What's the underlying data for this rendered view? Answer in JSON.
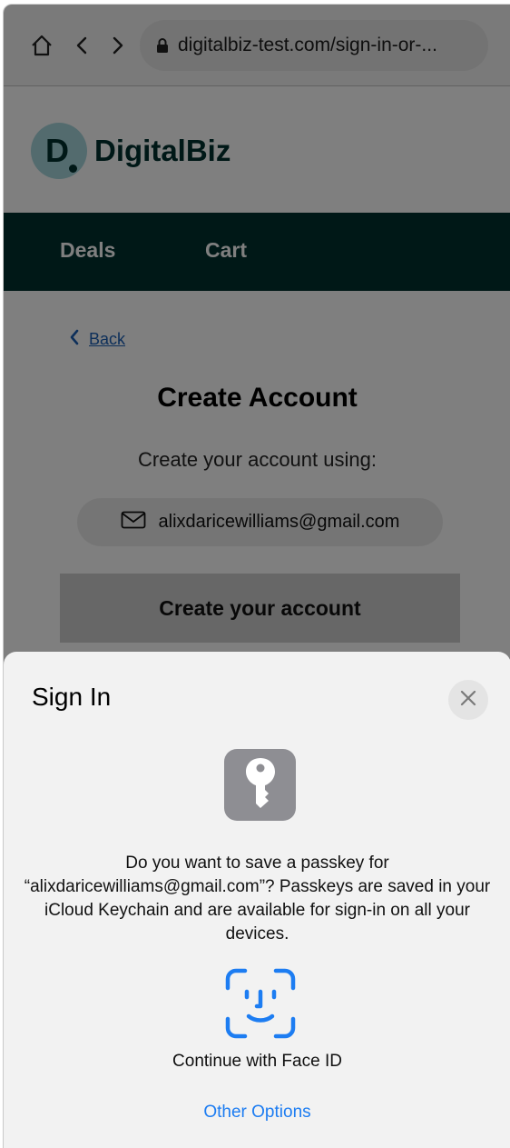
{
  "browser": {
    "url": "digitalbiz-test.com/sign-in-or-..."
  },
  "site": {
    "logo_letter": "D",
    "name": "DigitalBiz",
    "brand_color": "#00302f",
    "logo_bg_color": "#a6d6dd"
  },
  "nav": {
    "items": [
      {
        "label": "Deals"
      },
      {
        "label": "Cart"
      }
    ]
  },
  "page": {
    "back_label": "Back",
    "title": "Create Account",
    "subtitle": "Create your account using:",
    "email": "alixdaricewilliams@gmail.com",
    "create_button": "Create your account"
  },
  "sheet": {
    "title": "Sign In",
    "message": "Do you want to save a passkey for “alixdaricewilliams@gmail.com”? Passkeys are saved in your iCloud Keychain and are available for sign-in on all your devices.",
    "face_id_label": "Continue with Face ID",
    "other_options": "Other Options",
    "accent_color": "#1d7df2"
  },
  "icons": [
    "home-icon",
    "back-arrow-icon",
    "forward-arrow-icon",
    "lock-icon",
    "chevron-left-icon",
    "mail-icon",
    "close-icon",
    "key-icon",
    "face-id-icon"
  ]
}
